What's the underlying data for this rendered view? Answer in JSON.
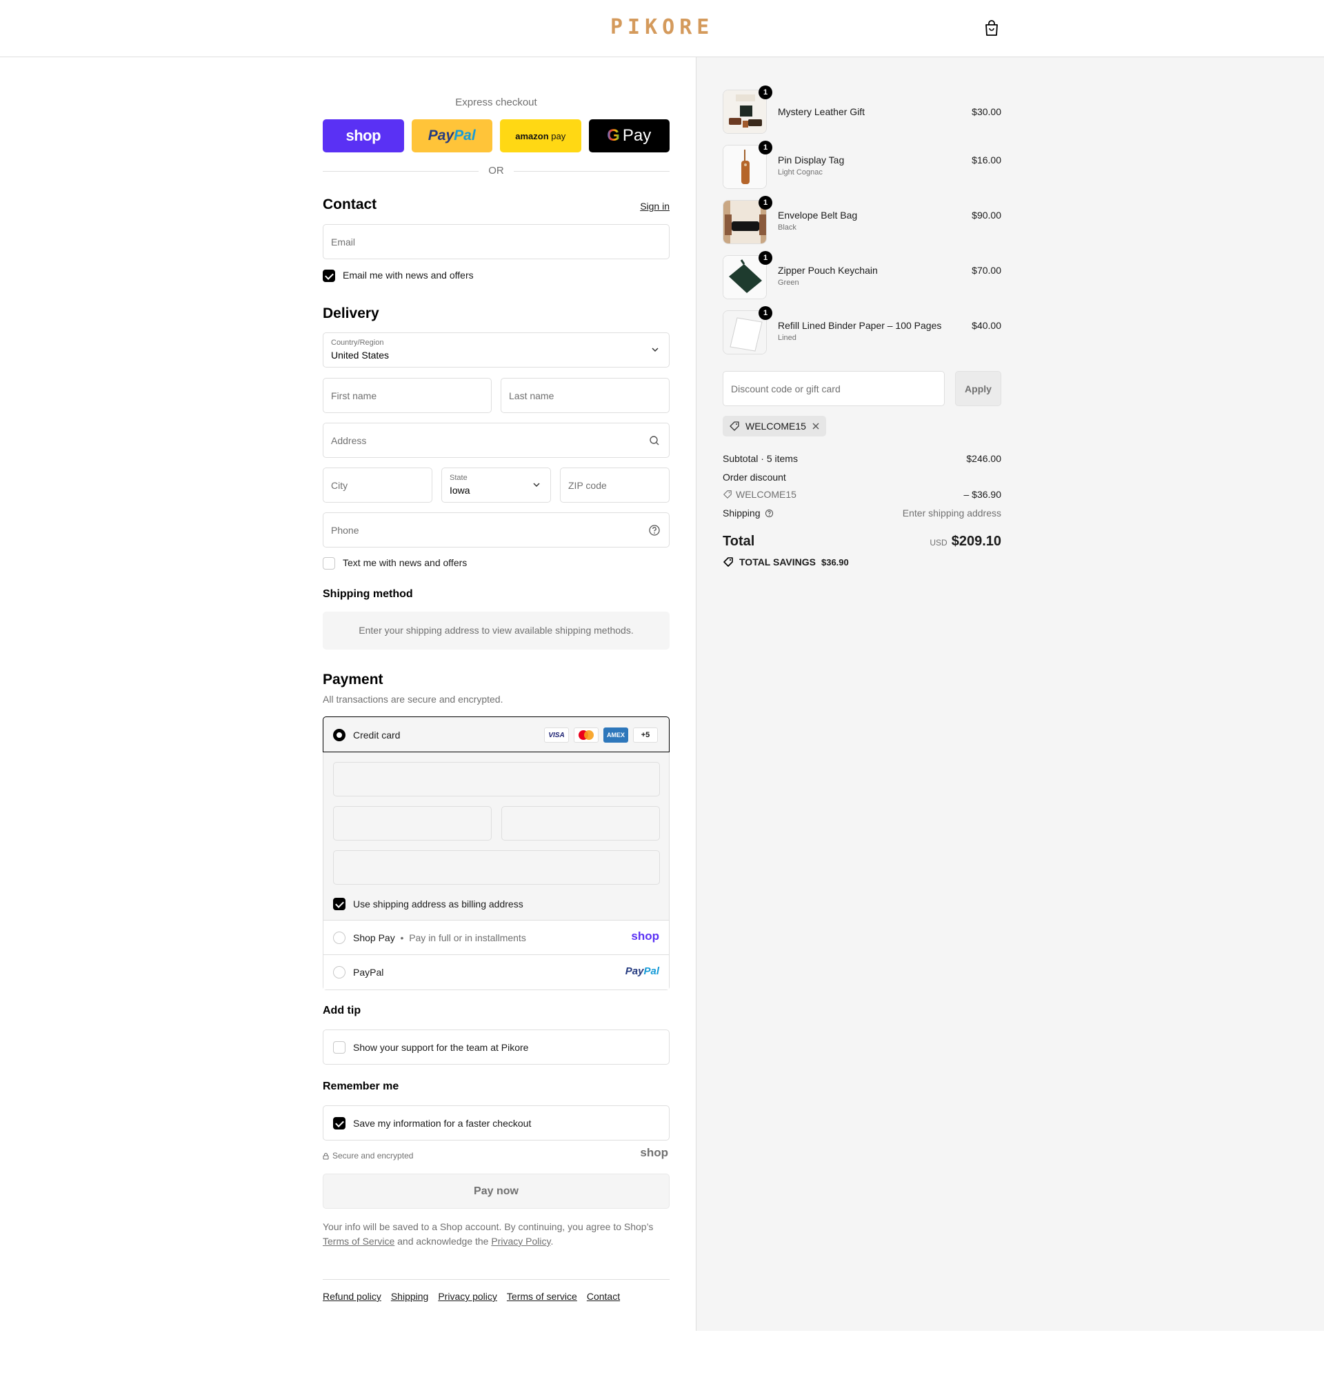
{
  "brand": {
    "name": "PIKORE",
    "color": "#d49a5c"
  },
  "header": {
    "cart_icon": "bag-icon"
  },
  "express": {
    "title": "Express checkout",
    "buttons": {
      "shop": "shop",
      "paypal_a": "Pay",
      "paypal_b": "Pal",
      "amazon_a": "amazon",
      "amazon_b": "pay",
      "gpay_g": "G",
      "gpay": "Pay"
    },
    "or": "OR"
  },
  "contact": {
    "title": "Contact",
    "sign_in": "Sign in",
    "email_placeholder": "Email",
    "news_label": "Email me with news and offers",
    "news_checked": true
  },
  "delivery": {
    "title": "Delivery",
    "country_label": "Country/Region",
    "country_value": "United States",
    "first_name": "First name",
    "last_name": "Last name",
    "address": "Address",
    "city": "City",
    "state_label": "State",
    "state_value": "Iowa",
    "zip": "ZIP code",
    "phone": "Phone",
    "text_label": "Text me with news and offers",
    "text_checked": false
  },
  "shipping_method": {
    "title": "Shipping method",
    "message": "Enter your shipping address to view available shipping methods."
  },
  "payment": {
    "title": "Payment",
    "subtitle": "All transactions are secure and encrypted.",
    "credit_card": "Credit card",
    "card_logos": {
      "visa": "VISA",
      "amex": "AMEX",
      "more": "+5"
    },
    "billing_label": "Use shipping address as billing address",
    "billing_checked": true,
    "shop_pay": "Shop Pay",
    "shop_pay_sub": "Pay in full or in installments",
    "shop_pay_logo": "shop",
    "paypal": "PayPal",
    "paypal_logo_a": "Pay",
    "paypal_logo_b": "Pal"
  },
  "tip": {
    "title": "Add tip",
    "label": "Show your support for the team at Pikore",
    "checked": false
  },
  "remember": {
    "title": "Remember me",
    "label": "Save my information for a faster checkout",
    "checked": true,
    "secure": "Secure and encrypted",
    "shop_logo": "shop"
  },
  "pay_now": "Pay now",
  "legal": {
    "text1": "Your info will be saved to a Shop account. By continuing, you agree to Shop’s",
    "terms": "Terms of Service",
    "text2": "and acknowledge the",
    "privacy": "Privacy Policy",
    "period": "."
  },
  "footer_links": [
    "Refund policy",
    "Shipping",
    "Privacy policy",
    "Terms of service",
    "Contact"
  ],
  "cart": {
    "items": [
      {
        "name": "Mystery Leather Gift",
        "variant": "",
        "price": "$30.00",
        "qty": "1"
      },
      {
        "name": "Pin Display Tag",
        "variant": "Light Cognac",
        "price": "$16.00",
        "qty": "1"
      },
      {
        "name": "Envelope Belt Bag",
        "variant": "Black",
        "price": "$90.00",
        "qty": "1"
      },
      {
        "name": "Zipper Pouch Keychain",
        "variant": "Green",
        "price": "$70.00",
        "qty": "1"
      },
      {
        "name": "Refill Lined Binder Paper – 100 Pages",
        "variant": "Lined",
        "price": "$40.00",
        "qty": "1"
      }
    ],
    "discount_placeholder": "Discount code or gift card",
    "apply": "Apply",
    "applied_code": "WELCOME15",
    "subtotal_label": "Subtotal · 5 items",
    "subtotal_value": "$246.00",
    "order_discount_label": "Order discount",
    "discount_code": "WELCOME15",
    "discount_value": "– $36.90",
    "shipping_label": "Shipping",
    "shipping_value": "Enter shipping address",
    "total_label": "Total",
    "currency": "USD",
    "total_value": "$209.10",
    "savings_label": "TOTAL SAVINGS",
    "savings_value": "$36.90"
  }
}
